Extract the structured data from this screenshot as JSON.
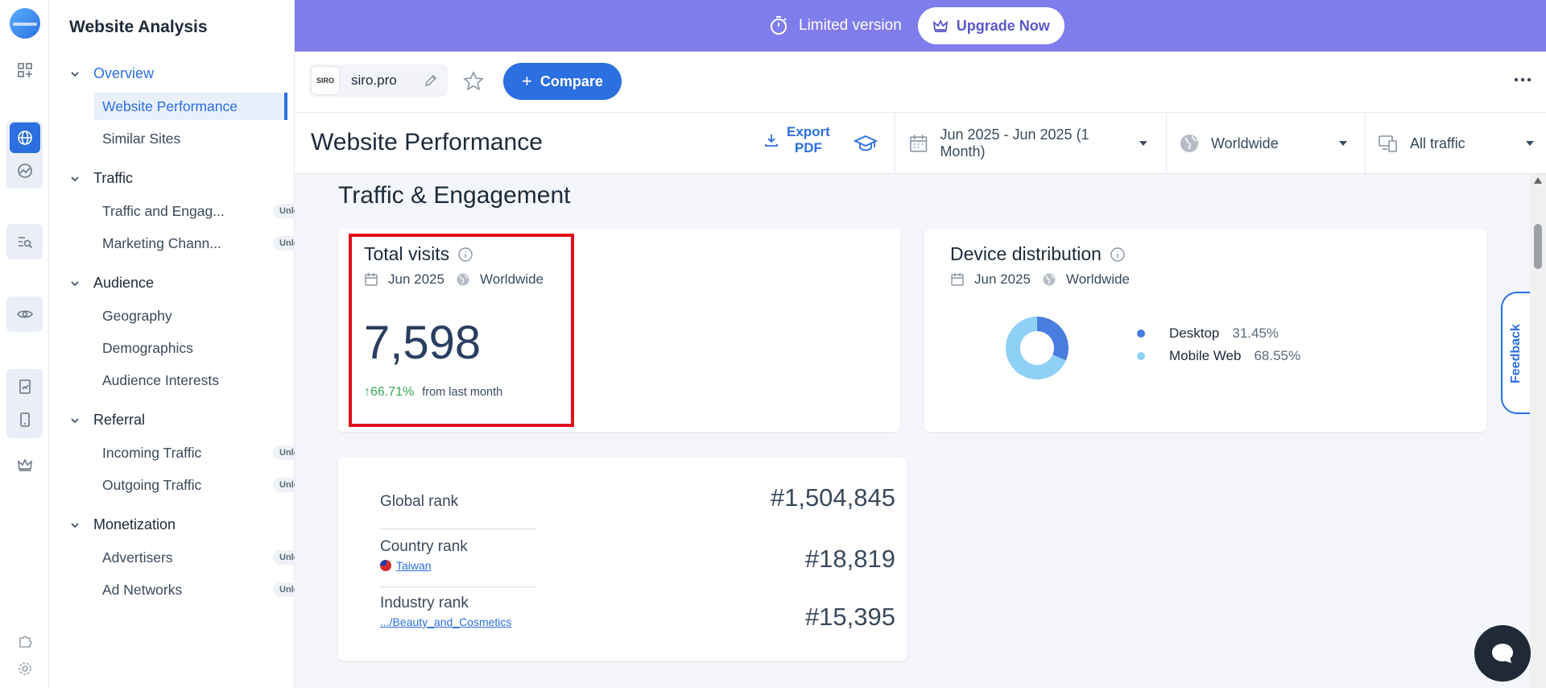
{
  "sidebar": {
    "title": "Website Analysis",
    "sections": [
      {
        "label": "Overview",
        "items": [
          {
            "label": "Website Performance",
            "unlock": ""
          },
          {
            "label": "Similar Sites",
            "unlock": ""
          }
        ]
      },
      {
        "label": "Traffic",
        "items": [
          {
            "label": "Traffic and Engag...",
            "unlock": "Unlock"
          },
          {
            "label": "Marketing Chann...",
            "unlock": "Unlock"
          }
        ]
      },
      {
        "label": "Audience",
        "items": [
          {
            "label": "Geography",
            "unlock": ""
          },
          {
            "label": "Demographics",
            "unlock": ""
          },
          {
            "label": "Audience Interests",
            "unlock": ""
          }
        ]
      },
      {
        "label": "Referral",
        "items": [
          {
            "label": "Incoming Traffic",
            "unlock": "Unlock"
          },
          {
            "label": "Outgoing Traffic",
            "unlock": "Unlock"
          }
        ]
      },
      {
        "label": "Monetization",
        "items": [
          {
            "label": "Advertisers",
            "unlock": "Unlock"
          },
          {
            "label": "Ad Networks",
            "unlock": "Unlock"
          }
        ]
      }
    ]
  },
  "banner": {
    "limited_label": "Limited version",
    "upgrade_label": "Upgrade Now"
  },
  "topbar": {
    "site_favicon_text": "SIRO",
    "site_name": "siro.pro",
    "compare_label": "Compare"
  },
  "header": {
    "page_title": "Website Performance",
    "export_line1": "Export",
    "export_line2": "PDF",
    "date_range": "Jun 2025 - Jun 2025 (1 Month)",
    "region": "Worldwide",
    "traffic_type": "All traffic"
  },
  "content": {
    "section_title": "Traffic & Engagement",
    "total_visits": {
      "title": "Total visits",
      "month": "Jun 2025",
      "region": "Worldwide",
      "value": "7,598",
      "growth": "66.71%",
      "growth_arrow": "↑",
      "growth_suffix": "from last month"
    },
    "device": {
      "title": "Device distribution",
      "month": "Jun 2025",
      "region": "Worldwide"
    },
    "ranks": {
      "global_label": "Global rank",
      "global_value": "#1,504,845",
      "country_label": "Country rank",
      "country_name": "Taiwan",
      "country_value": "#18,819",
      "industry_label": "Industry rank",
      "industry_name": ".../Beauty_and_Cosmetics",
      "industry_value": "#15,395"
    }
  },
  "feedback_label": "Feedback",
  "colors": {
    "accent": "#2b6fe0",
    "banner": "#7f7cec",
    "desktop": "#4a7de0",
    "mobile": "#8fd0f7",
    "growth": "#3aa757",
    "highlight": "#e0101c"
  },
  "chart_data": {
    "type": "pie",
    "categories": [
      "Desktop",
      "Mobile Web"
    ],
    "values": [
      31.45,
      68.55
    ],
    "labels": [
      "31.45%",
      "68.55%"
    ]
  }
}
